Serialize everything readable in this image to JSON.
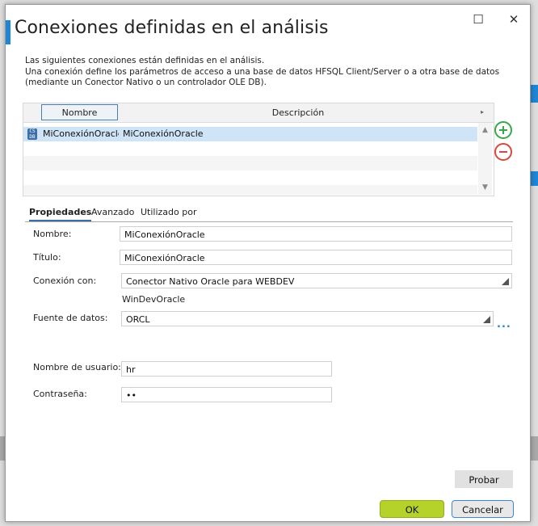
{
  "dialog": {
    "title": "Conexiones definidas en el análisis",
    "maximize_icon": "☐",
    "close_icon": "✕",
    "description": [
      "Las siguientes conexiones están definidas en el análisis.",
      "Una conexión define los parámetros de acceso a una base de datos HFSQL Client/Server o a otra base de datos",
      "(mediante un Conector Nativo o un controlador OLE DB)."
    ]
  },
  "grid": {
    "columns": [
      "Nombre",
      "Descripción"
    ],
    "rows": [
      {
        "name": "MiConexiónOracle",
        "description": "MiConexiónOracle",
        "icon": "database-icon"
      }
    ]
  },
  "tabs": [
    "Propiedades",
    "Avanzado",
    "Utilizado por"
  ],
  "properties": {
    "nombre_label": "Nombre:",
    "nombre_value": "MiConexiónOracle",
    "titulo_label": "Título:",
    "titulo_value": "MiConexiónOracle",
    "conexion_label": "Conexión con:",
    "conexion_value": "Conector Nativo Oracle para WEBDEV",
    "conexion_sub": "WinDevOracle",
    "fuente_label": "Fuente de datos:",
    "fuente_value": "ORCL",
    "usuario_label": "Nombre de usuario:",
    "usuario_value": "hr",
    "password_label": "Contraseña:",
    "password_value": "••"
  },
  "buttons": {
    "probar": "Probar",
    "ok": "OK",
    "cancel": "Cancelar",
    "more": "...",
    "add_icon": "add-circle-icon",
    "remove_icon": "remove-circle-icon"
  },
  "colors": {
    "accent": "#1e86d6",
    "ok_button": "#b4d22a",
    "selected_row": "#cfe4f7"
  }
}
